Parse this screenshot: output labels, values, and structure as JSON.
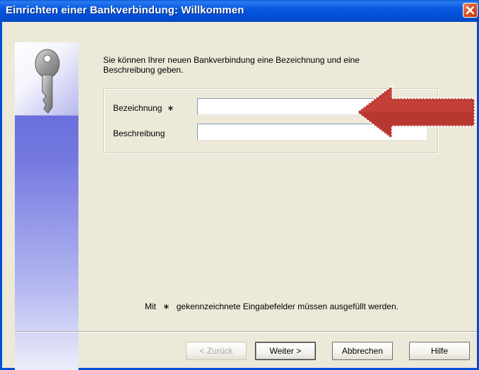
{
  "window": {
    "title": "Einrichten einer Bankverbindung: Willkommen"
  },
  "intro_text": "Sie können Ihrer neuen Bankverbindung eine Bezeichnung und eine Beschreibung geben.",
  "form": {
    "bezeichnung_label": "Bezeichnung",
    "bezeichnung_required_mark": "∗",
    "bezeichnung_value": "",
    "beschreibung_label": "Beschreibung",
    "beschreibung_value": ""
  },
  "footer_note": {
    "prefix": "Mit",
    "mark": "∗",
    "suffix": "gekennzeichnete Eingabefelder müssen ausgefüllt werden."
  },
  "buttons": {
    "back": "< Zurück",
    "next": "Weiter >",
    "cancel": "Abbrechen",
    "help": "Hilfe"
  },
  "icons": {
    "sidebar": "key-icon",
    "close": "close-icon",
    "annotation": "red-arrow-icon"
  },
  "colors": {
    "title_bar": "#0350d8",
    "close_button": "#d54a1c",
    "sidebar_gradient_top": "#5b5fd6",
    "annotation_arrow": "#c0392b"
  }
}
